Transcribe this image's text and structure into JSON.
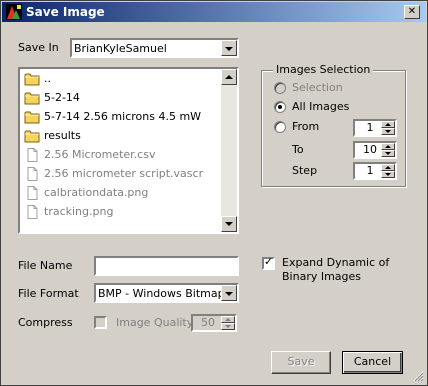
{
  "window": {
    "title": "Save Image",
    "close_symbol": "✕"
  },
  "save_in": {
    "label": "Save In",
    "value": "BrianKyleSamuel"
  },
  "file_list": [
    {
      "name": "..",
      "type": "folder"
    },
    {
      "name": "5-2-14",
      "type": "folder"
    },
    {
      "name": "5-7-14 2.56 microns 4.5 mW",
      "type": "folder"
    },
    {
      "name": "results",
      "type": "folder"
    },
    {
      "name": "2.56 Micrometer.csv",
      "type": "file"
    },
    {
      "name": "2.56 micrometer script.vascr",
      "type": "file"
    },
    {
      "name": "calbrationdata.png",
      "type": "file"
    },
    {
      "name": "tracking.png",
      "type": "file"
    }
  ],
  "images_selection": {
    "title": "Images Selection",
    "selection_label": "Selection",
    "all_images_label": "All Images",
    "from_label": "From",
    "to_label": "To",
    "step_label": "Step",
    "selected": "All Images",
    "from_value": "1",
    "to_value": "10",
    "step_value": "1"
  },
  "file_name": {
    "label": "File Name",
    "value": ""
  },
  "file_format": {
    "label": "File Format",
    "value": "BMP - Windows Bitmap"
  },
  "compress": {
    "label": "Compress",
    "checked": false,
    "image_quality_label": "Image Quality",
    "image_quality_value": "50"
  },
  "expand_dynamic": {
    "label_line1": "Expand Dynamic of",
    "label_line2": "Binary Images",
    "checked": true
  },
  "buttons": {
    "save": "Save",
    "cancel": "Cancel"
  },
  "colors": {
    "titlebar_start": "#0a246a",
    "titlebar_end": "#a6caf0",
    "dialog_bg": "#d4d0c8",
    "folder": "#f6d35b",
    "disabled_text": "#808080"
  }
}
